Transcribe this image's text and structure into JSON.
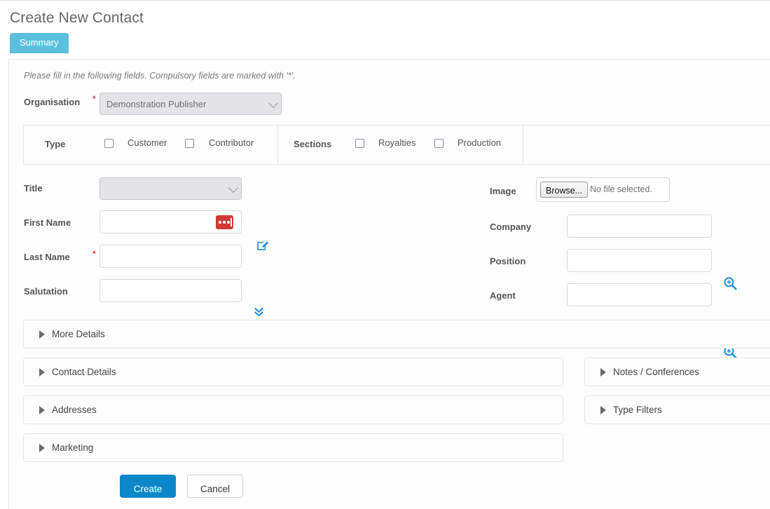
{
  "header": {
    "title": "Create New Contact",
    "tab": "Summary"
  },
  "form": {
    "helptext": "Please fill in the following fields. Compulsory fields are marked with '*'.",
    "required_marker": "*",
    "organisation": {
      "label": "Organisation",
      "value": "Demonstration Publisher",
      "required": true
    },
    "type_row": {
      "type_label": "Type",
      "type_options": [
        "Customer",
        "Contributor"
      ],
      "sections_label": "Sections",
      "sections_options": [
        "Royalties",
        "Production"
      ]
    },
    "left_fields": [
      {
        "label": "Title",
        "value": "",
        "control": "select",
        "required": false,
        "icon": "edit-square-icon"
      },
      {
        "label": "First Name",
        "value": "",
        "control": "text",
        "required": false,
        "icon": "red-dots-badge"
      },
      {
        "label": "Last Name",
        "value": "",
        "control": "text",
        "required": true,
        "icon": "double-chevron-down-icon"
      },
      {
        "label": "Salutation",
        "value": "",
        "control": "text",
        "required": false,
        "icon": ""
      }
    ],
    "right_fields": [
      {
        "label": "Image",
        "control": "file",
        "browse_label": "Browse...",
        "file_status": "No file selected.",
        "icon": ""
      },
      {
        "label": "Company",
        "value": "",
        "control": "text",
        "icon": "zoom-in-icon"
      },
      {
        "label": "Position",
        "value": "",
        "control": "text",
        "icon": ""
      },
      {
        "label": "Agent",
        "value": "",
        "control": "text",
        "icon": "zoom-in-icon"
      }
    ]
  },
  "accordions_left": [
    {
      "label": "More Details"
    },
    {
      "label": "Contact Details"
    },
    {
      "label": "Addresses"
    },
    {
      "label": "Marketing"
    }
  ],
  "accordions_right": [
    {
      "label": "Notes / Conferences"
    },
    {
      "label": "Type Filters"
    }
  ],
  "actions": {
    "create": "Create",
    "cancel": "Cancel"
  },
  "colors": {
    "tab_blue": "#5bc0de",
    "primary_blue": "#0b87c9",
    "icon_blue": "#1a8fd8",
    "required_red": "#e2402c",
    "badge_red": "#cf3b34",
    "label_gray": "#555555",
    "panel_border": "#e4e4e4"
  }
}
